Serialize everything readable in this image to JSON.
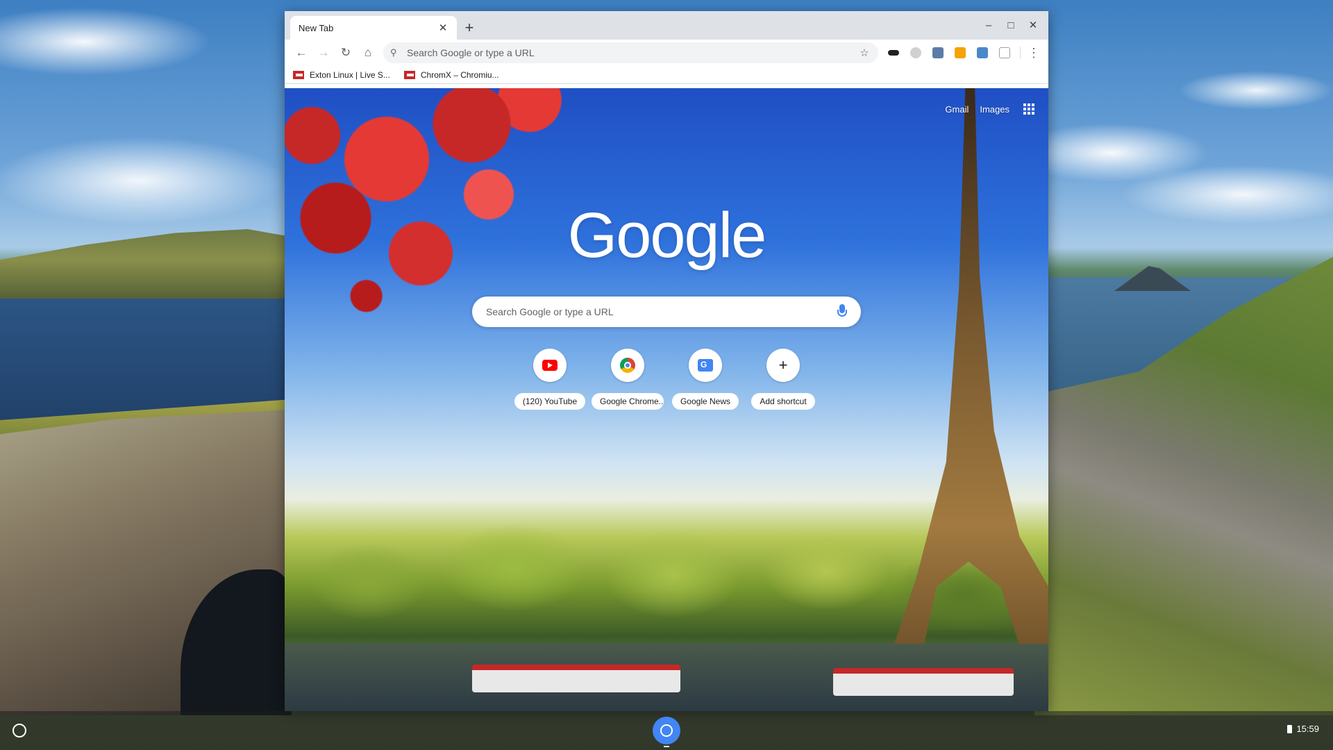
{
  "browser": {
    "tab": {
      "title": "New Tab",
      "close_icon": "close-icon"
    },
    "new_tab_symbol": "+",
    "window_controls": {
      "minimize": "–",
      "maximize": "□",
      "close": "✕"
    },
    "toolbar": {
      "back": "←",
      "forward": "→",
      "reload": "↻",
      "home": "⌂",
      "omnibox_placeholder": "Search Google or type a URL",
      "search_glyph": "⚲",
      "star": "☆",
      "menu": "⋮",
      "extensions": [
        {
          "name": "glasses-extension-icon",
          "color": "#202124"
        },
        {
          "name": "circle-extension-icon",
          "color": "#bdbdbd"
        },
        {
          "name": "puzzle-extension-icon",
          "color": "#5c7ca8"
        },
        {
          "name": "orange-extension-icon",
          "color": "#f4a300"
        },
        {
          "name": "blue-s-extension-icon",
          "color": "#4a88c7"
        },
        {
          "name": "square-extension-icon",
          "color": "#9e9e9e"
        }
      ]
    },
    "bookmarks": [
      {
        "label": "Exton Linux | Live S..."
      },
      {
        "label": "ChromX – Chromiu..."
      }
    ]
  },
  "ntp": {
    "links": {
      "gmail": "Gmail",
      "images": "Images"
    },
    "logo": "Google",
    "search_placeholder": "Search Google or type a URL",
    "shortcuts": [
      {
        "label": "(120) YouTube"
      },
      {
        "label": "Google Chrome..."
      },
      {
        "label": "Google News"
      },
      {
        "label": "Add shortcut"
      }
    ],
    "add_symbol": "+"
  },
  "shelf": {
    "time": "15:59"
  }
}
